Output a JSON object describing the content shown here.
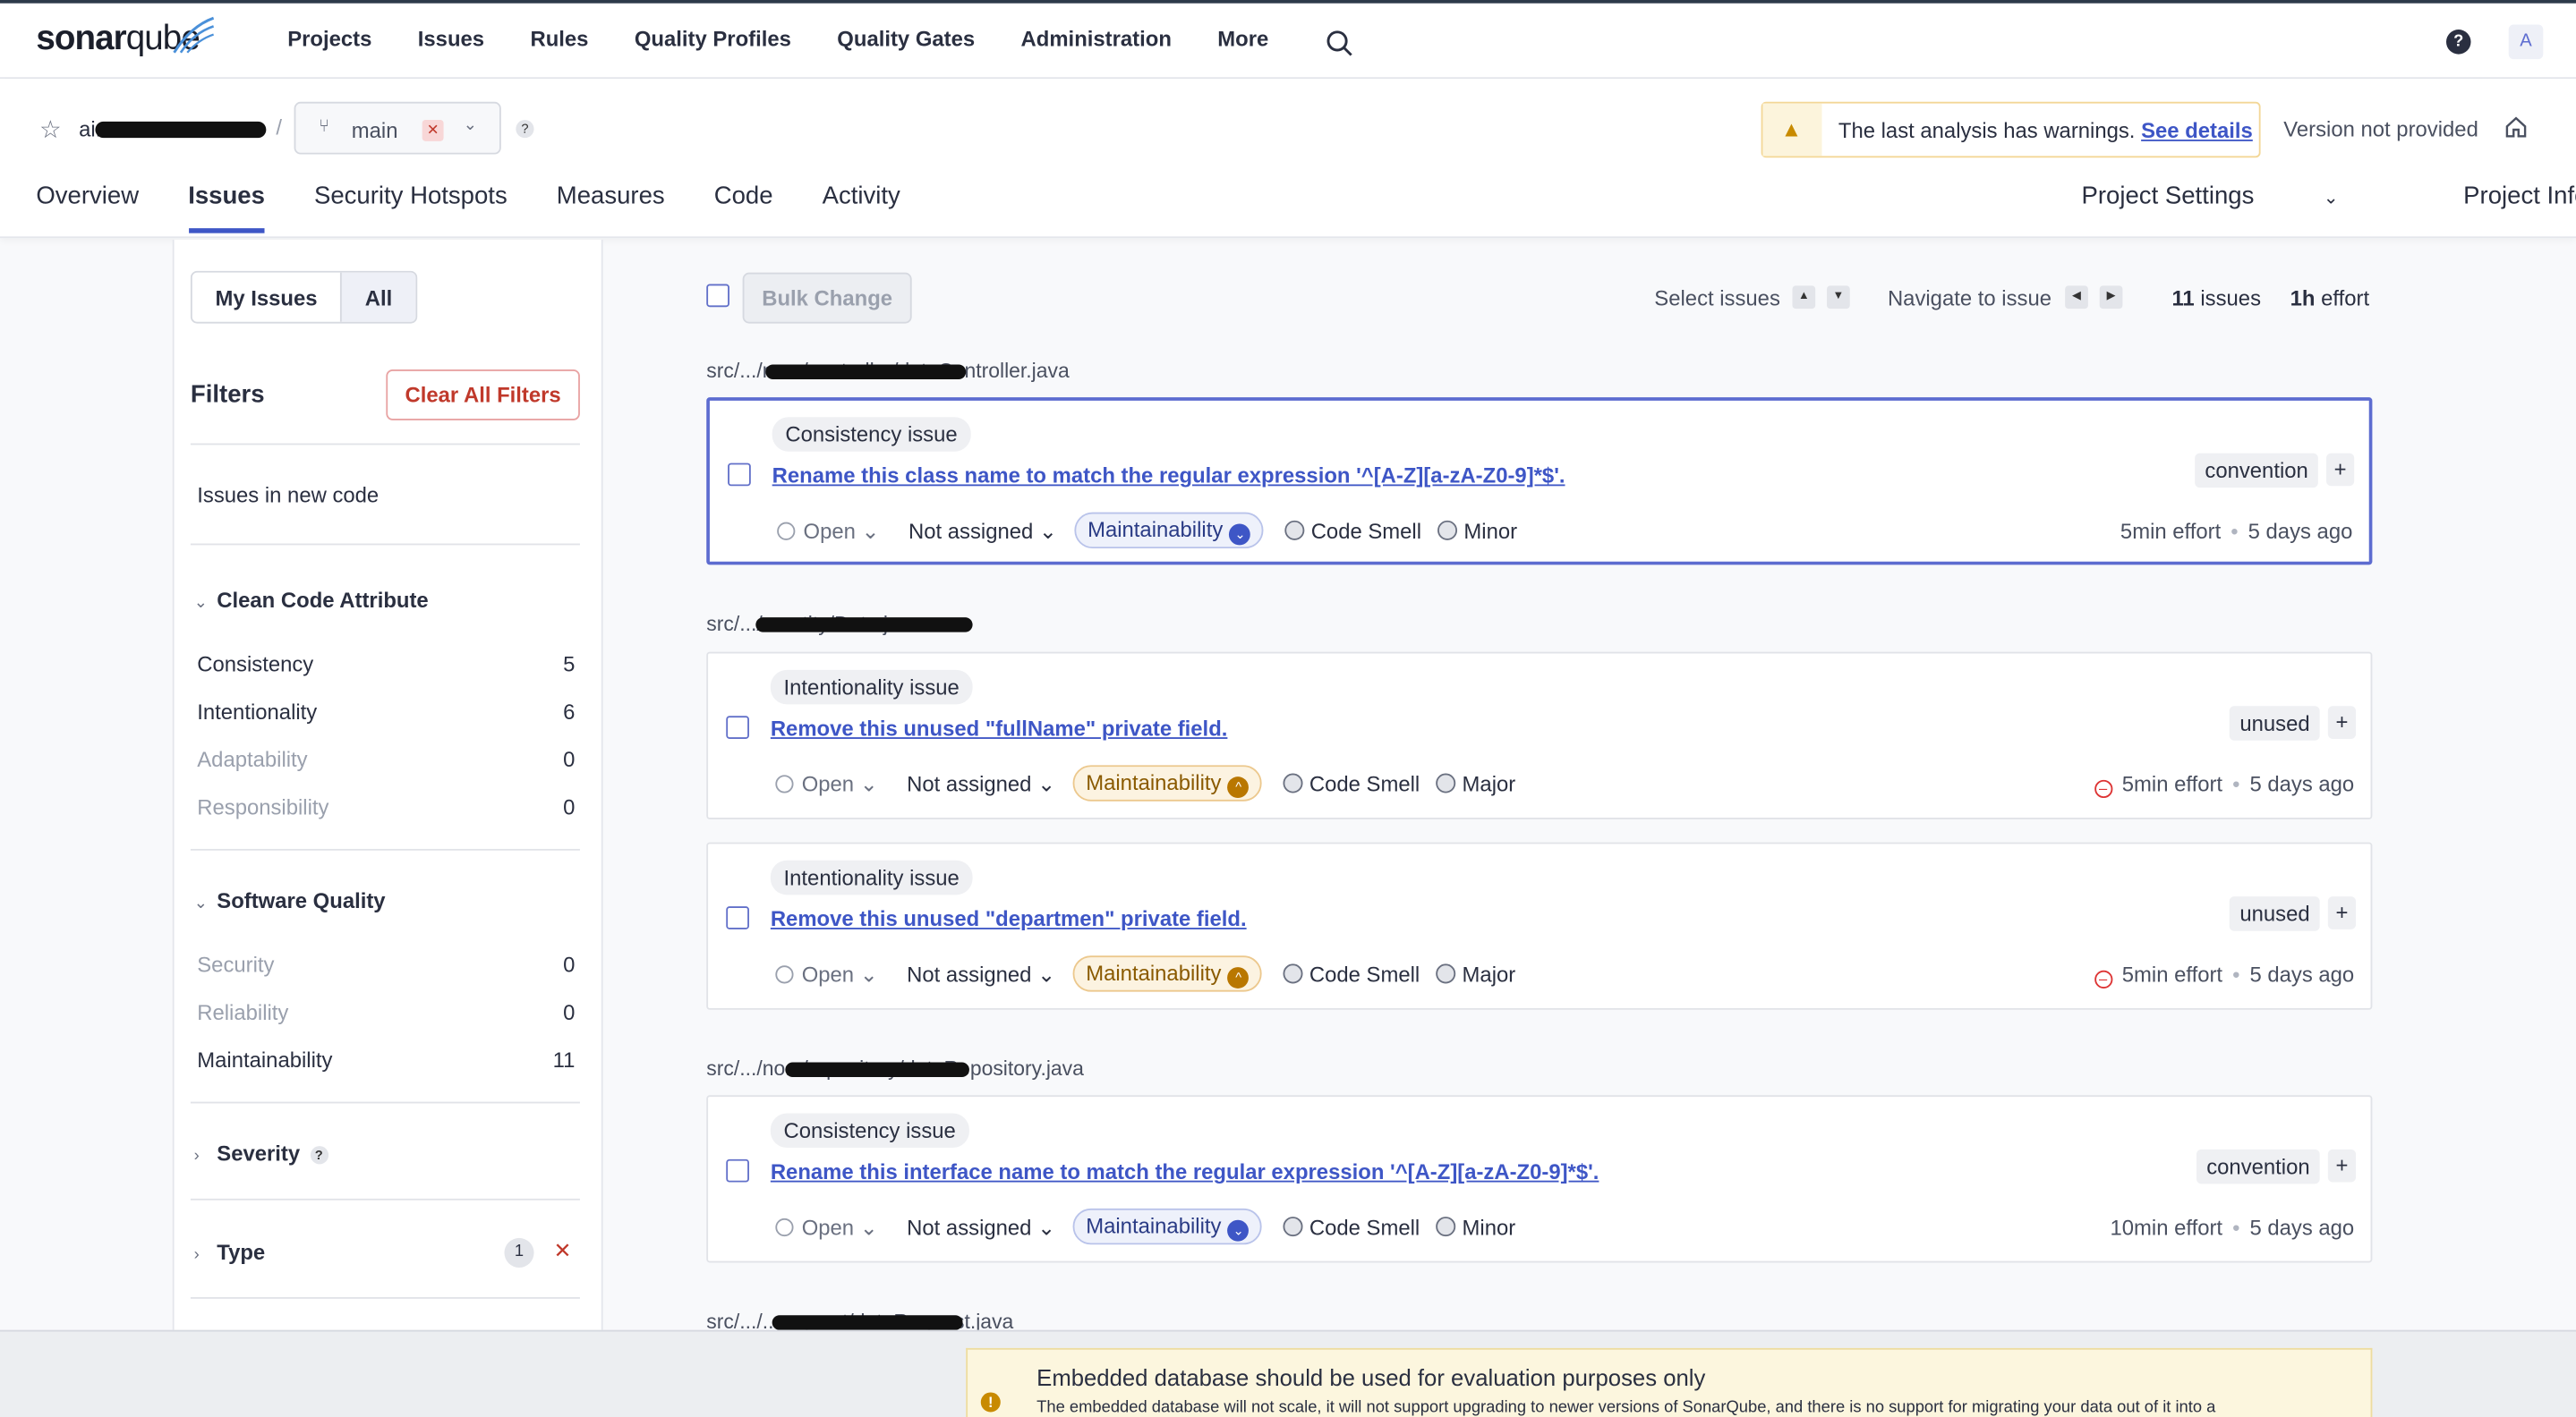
{
  "app": {
    "logo_bold": "sonar",
    "logo_light": "qube",
    "nav": [
      "Projects",
      "Issues",
      "Rules",
      "Quality Profiles",
      "Quality Gates",
      "Administration",
      "More"
    ],
    "avatar": "A"
  },
  "project": {
    "name": "ai.e...o",
    "branch": "main",
    "warning_text": "The last analysis has warnings.",
    "warning_link": "See details",
    "version": "Version not provided",
    "tabs": [
      "Overview",
      "Issues",
      "Security Hotspots",
      "Measures",
      "Code",
      "Activity"
    ],
    "active_tab": "Issues",
    "right_tabs": [
      "Project Settings",
      "Project Information"
    ]
  },
  "sidebar": {
    "my_issues": "My Issues",
    "all": "All",
    "filters_title": "Filters",
    "clear_all": "Clear All Filters",
    "new_code": "Issues in new code",
    "clean_code_title": "Clean Code Attribute",
    "clean_code": [
      {
        "label": "Consistency",
        "count": "5"
      },
      {
        "label": "Intentionality",
        "count": "6"
      },
      {
        "label": "Adaptability",
        "count": "0"
      },
      {
        "label": "Responsibility",
        "count": "0"
      }
    ],
    "software_quality_title": "Software Quality",
    "software_quality": [
      {
        "label": "Security",
        "count": "0"
      },
      {
        "label": "Reliability",
        "count": "0"
      },
      {
        "label": "Maintainability",
        "count": "11"
      }
    ],
    "severity_title": "Severity",
    "type_title": "Type",
    "type_count": "1"
  },
  "toolbar": {
    "bulk_change": "Bulk Change",
    "select_issues": "Select issues",
    "navigate": "Navigate to issue",
    "issues_count": "11",
    "issues_label": "issues",
    "effort_value": "1h",
    "effort_label": "effort"
  },
  "files": [
    "src/.../n...o/controller/dataController.java",
    "src/.../...entity/Data.java",
    "src/.../no.../repository/dataRepository.java",
    "src/.../...request/dataRequest.java"
  ],
  "issues": [
    {
      "attribute": "Consistency issue",
      "message": "Rename this class name to match the regular expression '^[A-Z][a-zA-Z0-9]*$'.",
      "tag": "convention",
      "status": "Open",
      "assignee": "Not assigned",
      "quality": "Maintainability",
      "type": "Code Smell",
      "severity": "Minor",
      "effort": "5min effort",
      "age": "5 days ago"
    },
    {
      "attribute": "Intentionality issue",
      "message": "Remove this unused \"fullName\" private field.",
      "tag": "unused",
      "status": "Open",
      "assignee": "Not assigned",
      "quality": "Maintainability",
      "type": "Code Smell",
      "severity": "Major",
      "effort": "5min effort",
      "age": "5 days ago"
    },
    {
      "attribute": "Intentionality issue",
      "message": "Remove this unused \"departmen\" private field.",
      "tag": "unused",
      "status": "Open",
      "assignee": "Not assigned",
      "quality": "Maintainability",
      "type": "Code Smell",
      "severity": "Major",
      "effort": "5min effort",
      "age": "5 days ago"
    },
    {
      "attribute": "Consistency issue",
      "message": "Rename this interface name to match the regular expression '^[A-Z][a-zA-Z0-9]*$'.",
      "tag": "convention",
      "status": "Open",
      "assignee": "Not assigned",
      "quality": "Maintainability",
      "type": "Code Smell",
      "severity": "Minor",
      "effort": "10min effort",
      "age": "5 days ago"
    }
  ],
  "footer": {
    "title": "Embedded database should be used for evaluation purposes only",
    "subtitle": "The embedded database will not scale, it will not support upgrading to newer versions of SonarQube, and there is no support for migrating your data out of it into a"
  },
  "colors": {
    "accent": "#3e56c6",
    "warning": "#c88a00",
    "danger": "#c0392b"
  }
}
